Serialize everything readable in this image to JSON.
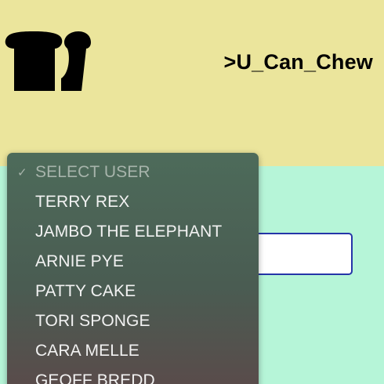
{
  "header": {
    "brand_title": ">U_Can_Chew",
    "logo_icon": "bread-slices-icon",
    "background_color": "#ebe59c"
  },
  "main": {
    "background_color": "#b6f5d8",
    "input_value": ""
  },
  "user_select": {
    "selected_label": "SELECT USER",
    "check_glyph": "✓",
    "options": [
      "SELECT USER",
      "TERRY REX",
      "JAMBO THE ELEPHANT",
      "ARNIE PYE",
      "PATTY CAKE",
      "TORI SPONGE",
      "CARA MELLE",
      "GEOFF BREDD"
    ]
  }
}
